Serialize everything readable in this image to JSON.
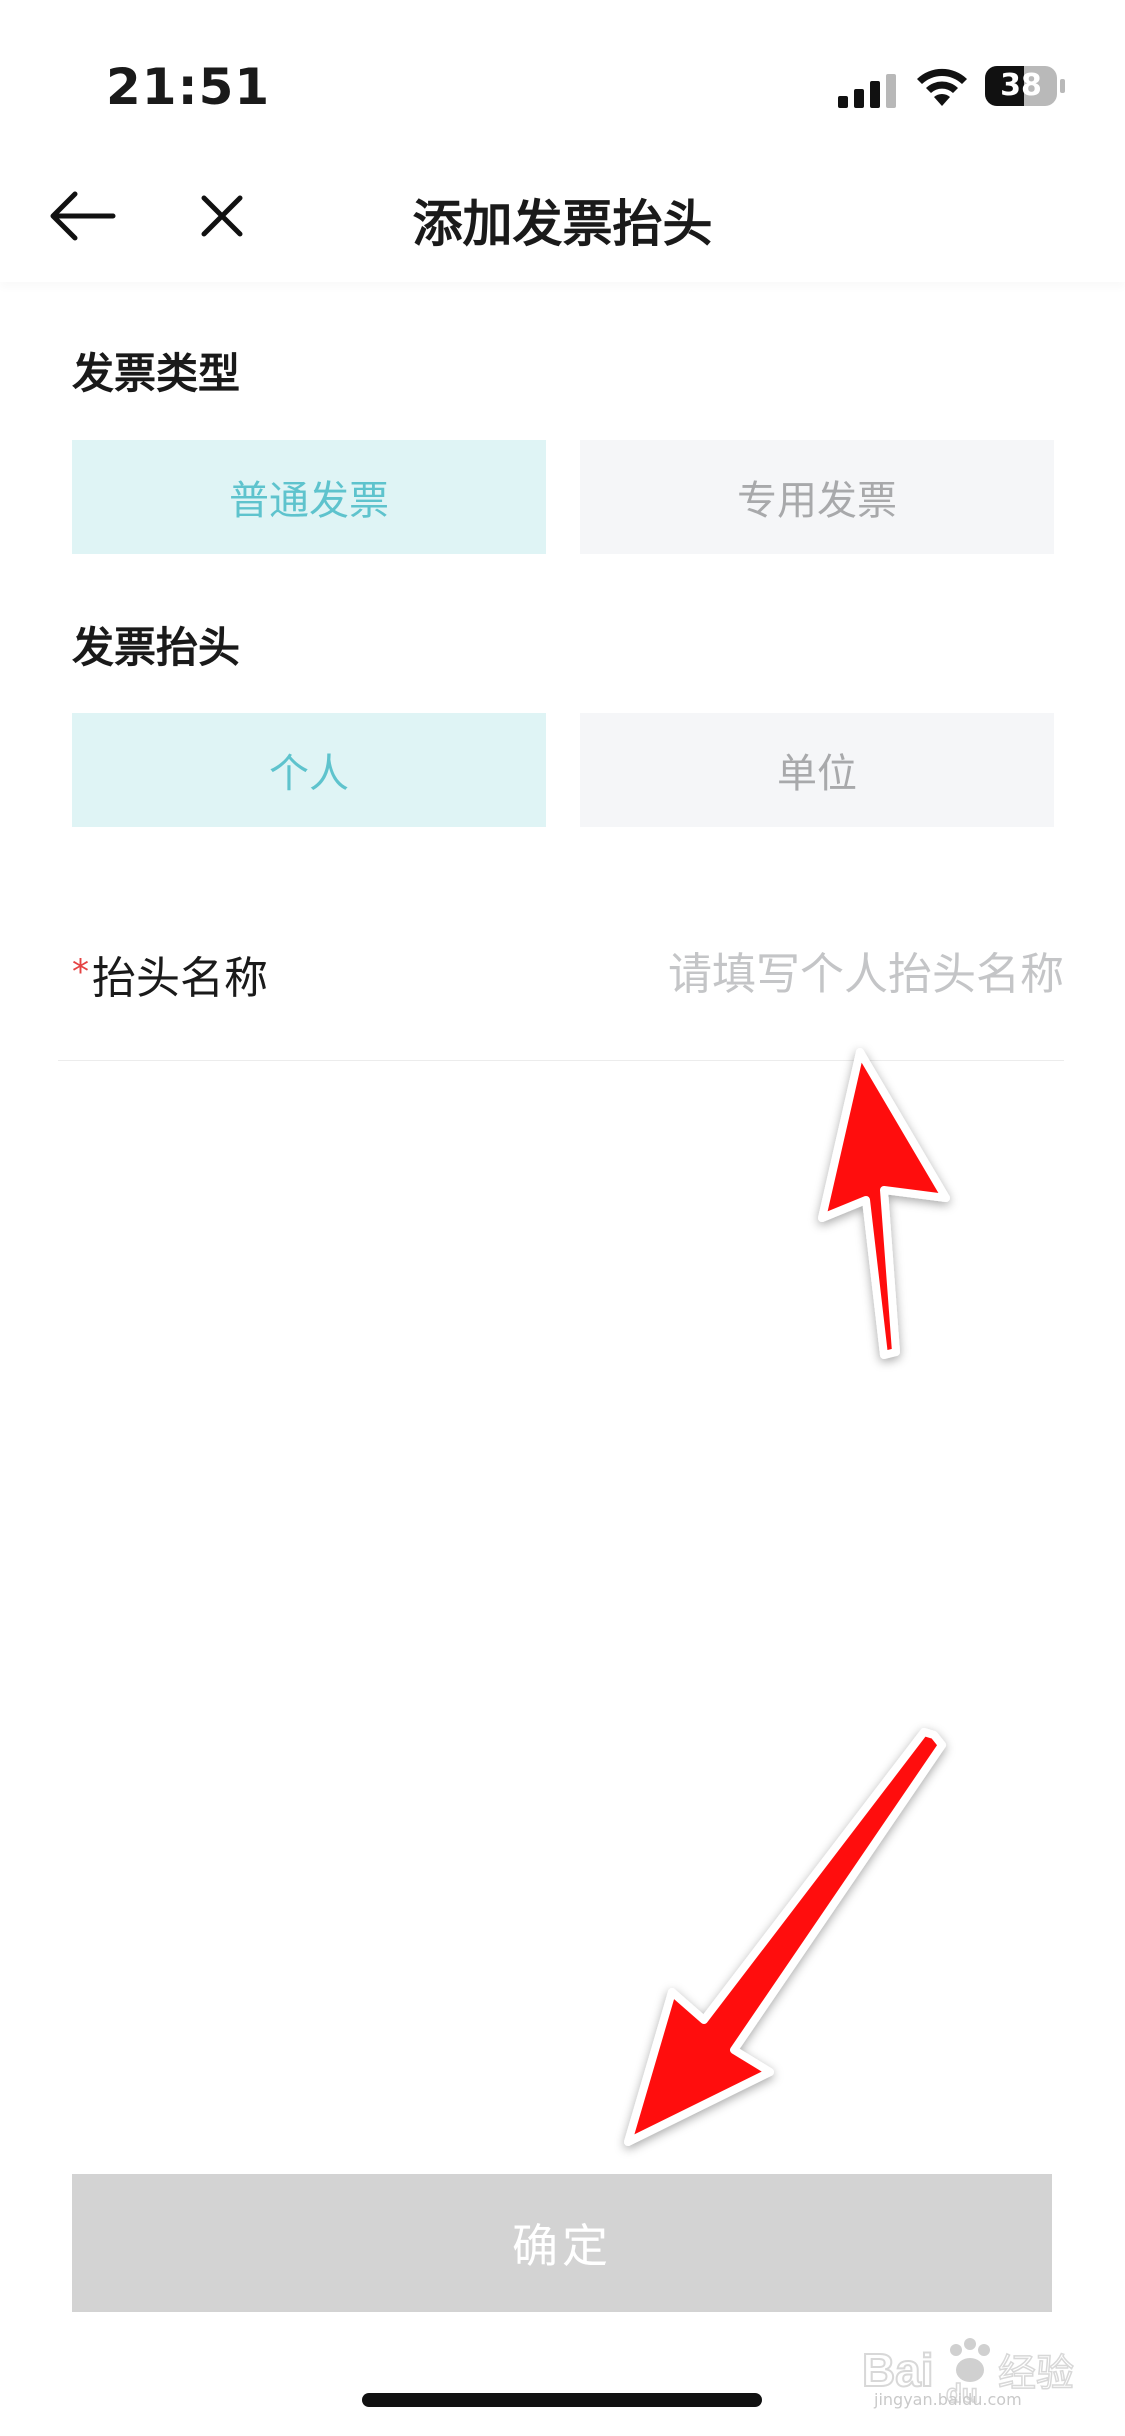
{
  "status_bar": {
    "time": "21:51",
    "battery_level": "38"
  },
  "nav": {
    "title": "添加发票抬头",
    "back_icon": "arrow-left-icon",
    "close_icon": "close-icon"
  },
  "invoice_type": {
    "title": "发票类型",
    "options": [
      {
        "label": "普通发票",
        "selected": true
      },
      {
        "label": "专用发票",
        "selected": false
      }
    ]
  },
  "invoice_header": {
    "title": "发票抬头",
    "options": [
      {
        "label": "个人",
        "selected": true
      },
      {
        "label": "单位",
        "selected": false
      }
    ]
  },
  "header_name_field": {
    "required_mark": "*",
    "label": "抬头名称",
    "value": "",
    "placeholder": "请填写个人抬头名称"
  },
  "confirm_button": {
    "label": "确定"
  },
  "watermark": {
    "text": "Bai 经验",
    "url_text": "jingyan.baidu.com"
  },
  "colors": {
    "selected_bg": "#dff4f5",
    "selected_text": "#5ec3cd",
    "unselected_bg": "#f5f6f8",
    "unselected_text": "#a8a9ab",
    "confirm_bg_disabled": "#d3d3d3",
    "required": "#e54242",
    "annotation_arrow": "#ff0000"
  }
}
